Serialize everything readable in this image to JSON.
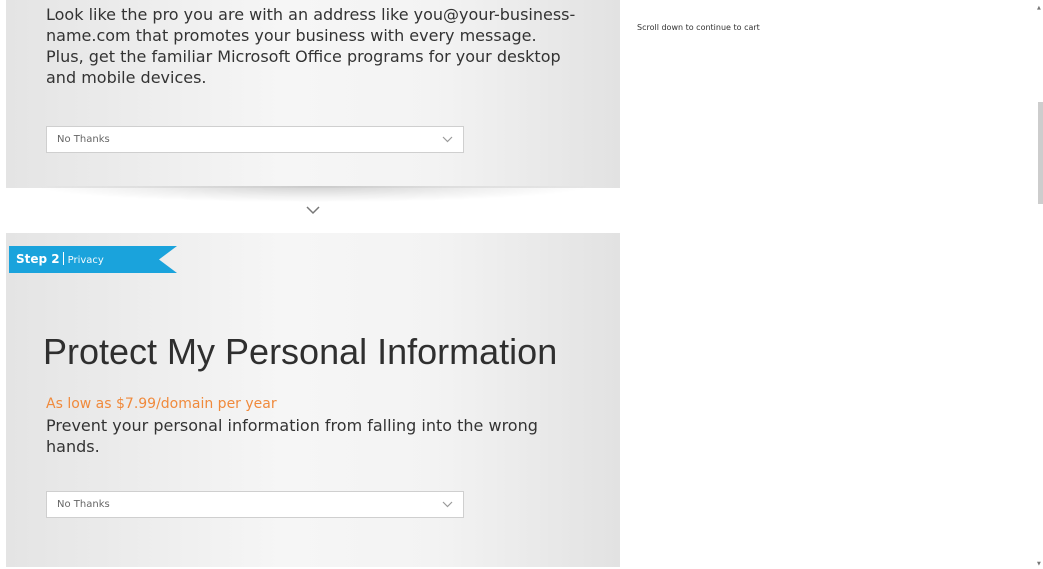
{
  "email_section": {
    "description": "Look like the pro you are with an address like you@your-business-name.com that promotes your business with every message. Plus, get the familiar Microsoft Office programs for your desktop and mobile devices.",
    "select_value": "No Thanks",
    "expand_icon": "chevron-down-icon"
  },
  "privacy_section": {
    "step_number": "Step 2",
    "step_label": "Privacy",
    "banner_color": "#1aa3dc",
    "title": "Protect My Personal Information",
    "price": "As low as $7.99/domain per year",
    "price_color": "#f08a3c",
    "description": "Prevent your personal information from falling into the wrong hands.",
    "select_value": "No Thanks"
  },
  "sidebar": {
    "scroll_hint": "Scroll down to continue to cart"
  }
}
